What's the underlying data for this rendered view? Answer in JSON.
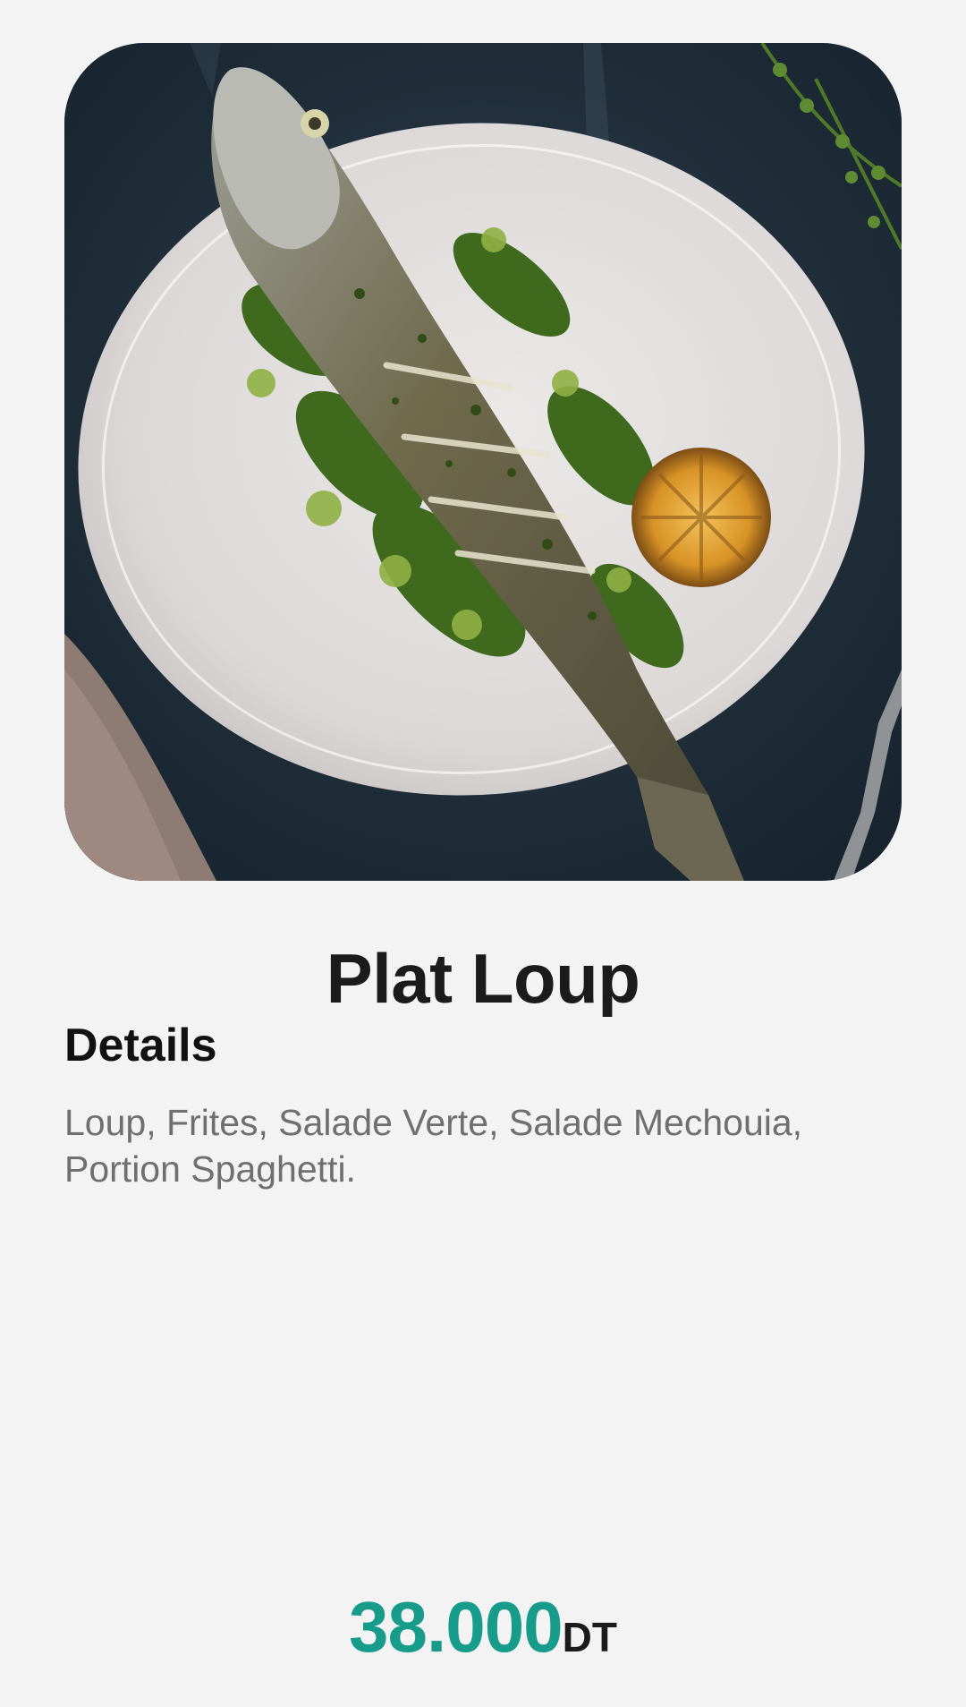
{
  "dish": {
    "name": "Plat Loup",
    "image_subject": "grilled-sea-bass-on-plate"
  },
  "details": {
    "heading": "Details",
    "description": "Loup, Frites, Salade Verte, Salade Mechouia, Portion Spaghetti."
  },
  "price": {
    "amount": "38.000",
    "currency": "DT"
  },
  "colors": {
    "background": "#f3f3f3",
    "price_accent": "#179c8c",
    "title_text": "#1b1b1b",
    "description_text": "#6f6f6f"
  }
}
